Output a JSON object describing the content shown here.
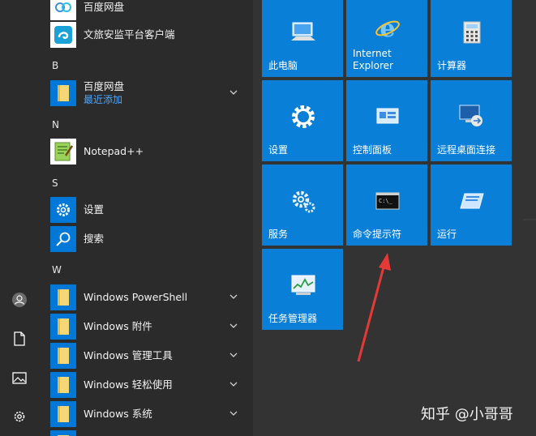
{
  "app_list": {
    "top_items": [
      {
        "label": "百度网盘"
      },
      {
        "label": "文旅安监平台客户端"
      }
    ],
    "groups": [
      {
        "letter": "B",
        "items": [
          {
            "label": "百度网盘",
            "sub": "最近添加",
            "expand": true
          }
        ]
      },
      {
        "letter": "N",
        "items": [
          {
            "label": "Notepad++"
          }
        ]
      },
      {
        "letter": "S",
        "items": [
          {
            "label": "设置"
          },
          {
            "label": "搜索"
          }
        ]
      },
      {
        "letter": "W",
        "items": [
          {
            "label": "Windows PowerShell",
            "expand": true
          },
          {
            "label": "Windows 附件",
            "expand": true
          },
          {
            "label": "Windows 管理工具",
            "expand": true
          },
          {
            "label": "Windows 轻松使用",
            "expand": true
          },
          {
            "label": "Windows 系统",
            "expand": true
          }
        ]
      }
    ]
  },
  "tiles": [
    {
      "label": "此电脑",
      "icon": "computer-icon"
    },
    {
      "label": "Internet\nExplorer",
      "label1": "Internet",
      "label2": "Explorer",
      "icon": "internet-explorer-icon"
    },
    {
      "label": "计算器",
      "icon": "calculator-icon"
    },
    {
      "label": "设置",
      "icon": "gear-icon"
    },
    {
      "label": "控制面板",
      "icon": "control-panel-icon"
    },
    {
      "label": "远程桌面连接",
      "icon": "remote-desktop-icon"
    },
    {
      "label": "服务",
      "icon": "services-gear-icon"
    },
    {
      "label": "命令提示符",
      "icon": "command-prompt-icon"
    },
    {
      "label": "运行",
      "icon": "run-icon"
    },
    {
      "label": "任务管理器",
      "icon": "task-manager-icon"
    }
  ],
  "watermark": "知乎 @小哥哥",
  "colors": {
    "tile": "#0a7fd8",
    "accent_text": "#4aa8ff",
    "arrow": "#e53935"
  }
}
